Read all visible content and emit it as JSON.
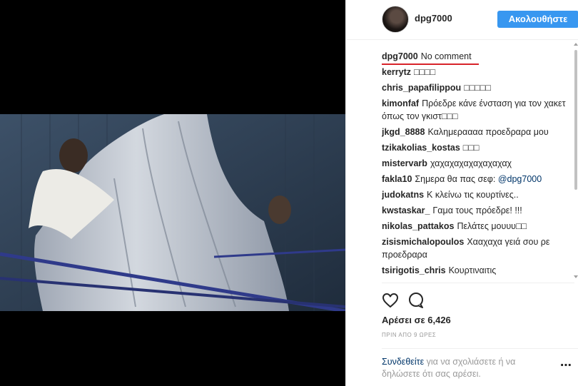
{
  "post": {
    "username": "dpg7000",
    "follow_label": "Ακολουθήστε",
    "caption": {
      "user": "dpg7000",
      "text": "No comment"
    },
    "comments": [
      {
        "user": "kerrytz",
        "text": "□□□□"
      },
      {
        "user": "chris_papafilippou",
        "text": "□□□□□"
      },
      {
        "user": "kimonfaf",
        "text": "Πρόεδρε κάνε ένσταση για τον χακετ όπως τον γκιστ□□□"
      },
      {
        "user": "jkgd_8888",
        "text": "Καλημεραααα προεδραρα μου"
      },
      {
        "user": "tzikakolias_kostas",
        "text": "□□□"
      },
      {
        "user": "mistervarb",
        "text": "χαχαχαχαχαχαχαχαχ"
      },
      {
        "user": "fakla10",
        "text": "Σημερα θα πας σεφ:",
        "mention": "@dpg7000"
      },
      {
        "user": "judokatns",
        "text": "Κ κλείνω τις κουρτίνες.."
      },
      {
        "user": "kwstaskar_",
        "text": "Γαμα τους πρόεδρε! !!!"
      },
      {
        "user": "nikolas_pattakos",
        "text": "Πελάτες μουυυ□□"
      },
      {
        "user": "zisismichalopoulos",
        "text": "Χααχαχα γειά σου ρε προεδραρα"
      },
      {
        "user": "tsirigotis_chris",
        "text": "Κουρτιναιτις"
      }
    ],
    "likes_text": "Αρέσει σε 6,426",
    "timestamp": "ΠΡΙΝ ΑΠΟ 9 ΩΡΕΣ",
    "login": {
      "link": "Συνδεθείτε",
      "text": " για να σχολιάσετε ή να δηλώσετε ότι σας αρέσει."
    },
    "more_symbol": "⋯",
    "icons": {
      "like": "heart-icon",
      "comment": "comment-bubble-icon",
      "more": "more-options-icon"
    },
    "colors": {
      "accent": "#3897f0",
      "link": "#003569",
      "underline": "#d8232a"
    }
  }
}
